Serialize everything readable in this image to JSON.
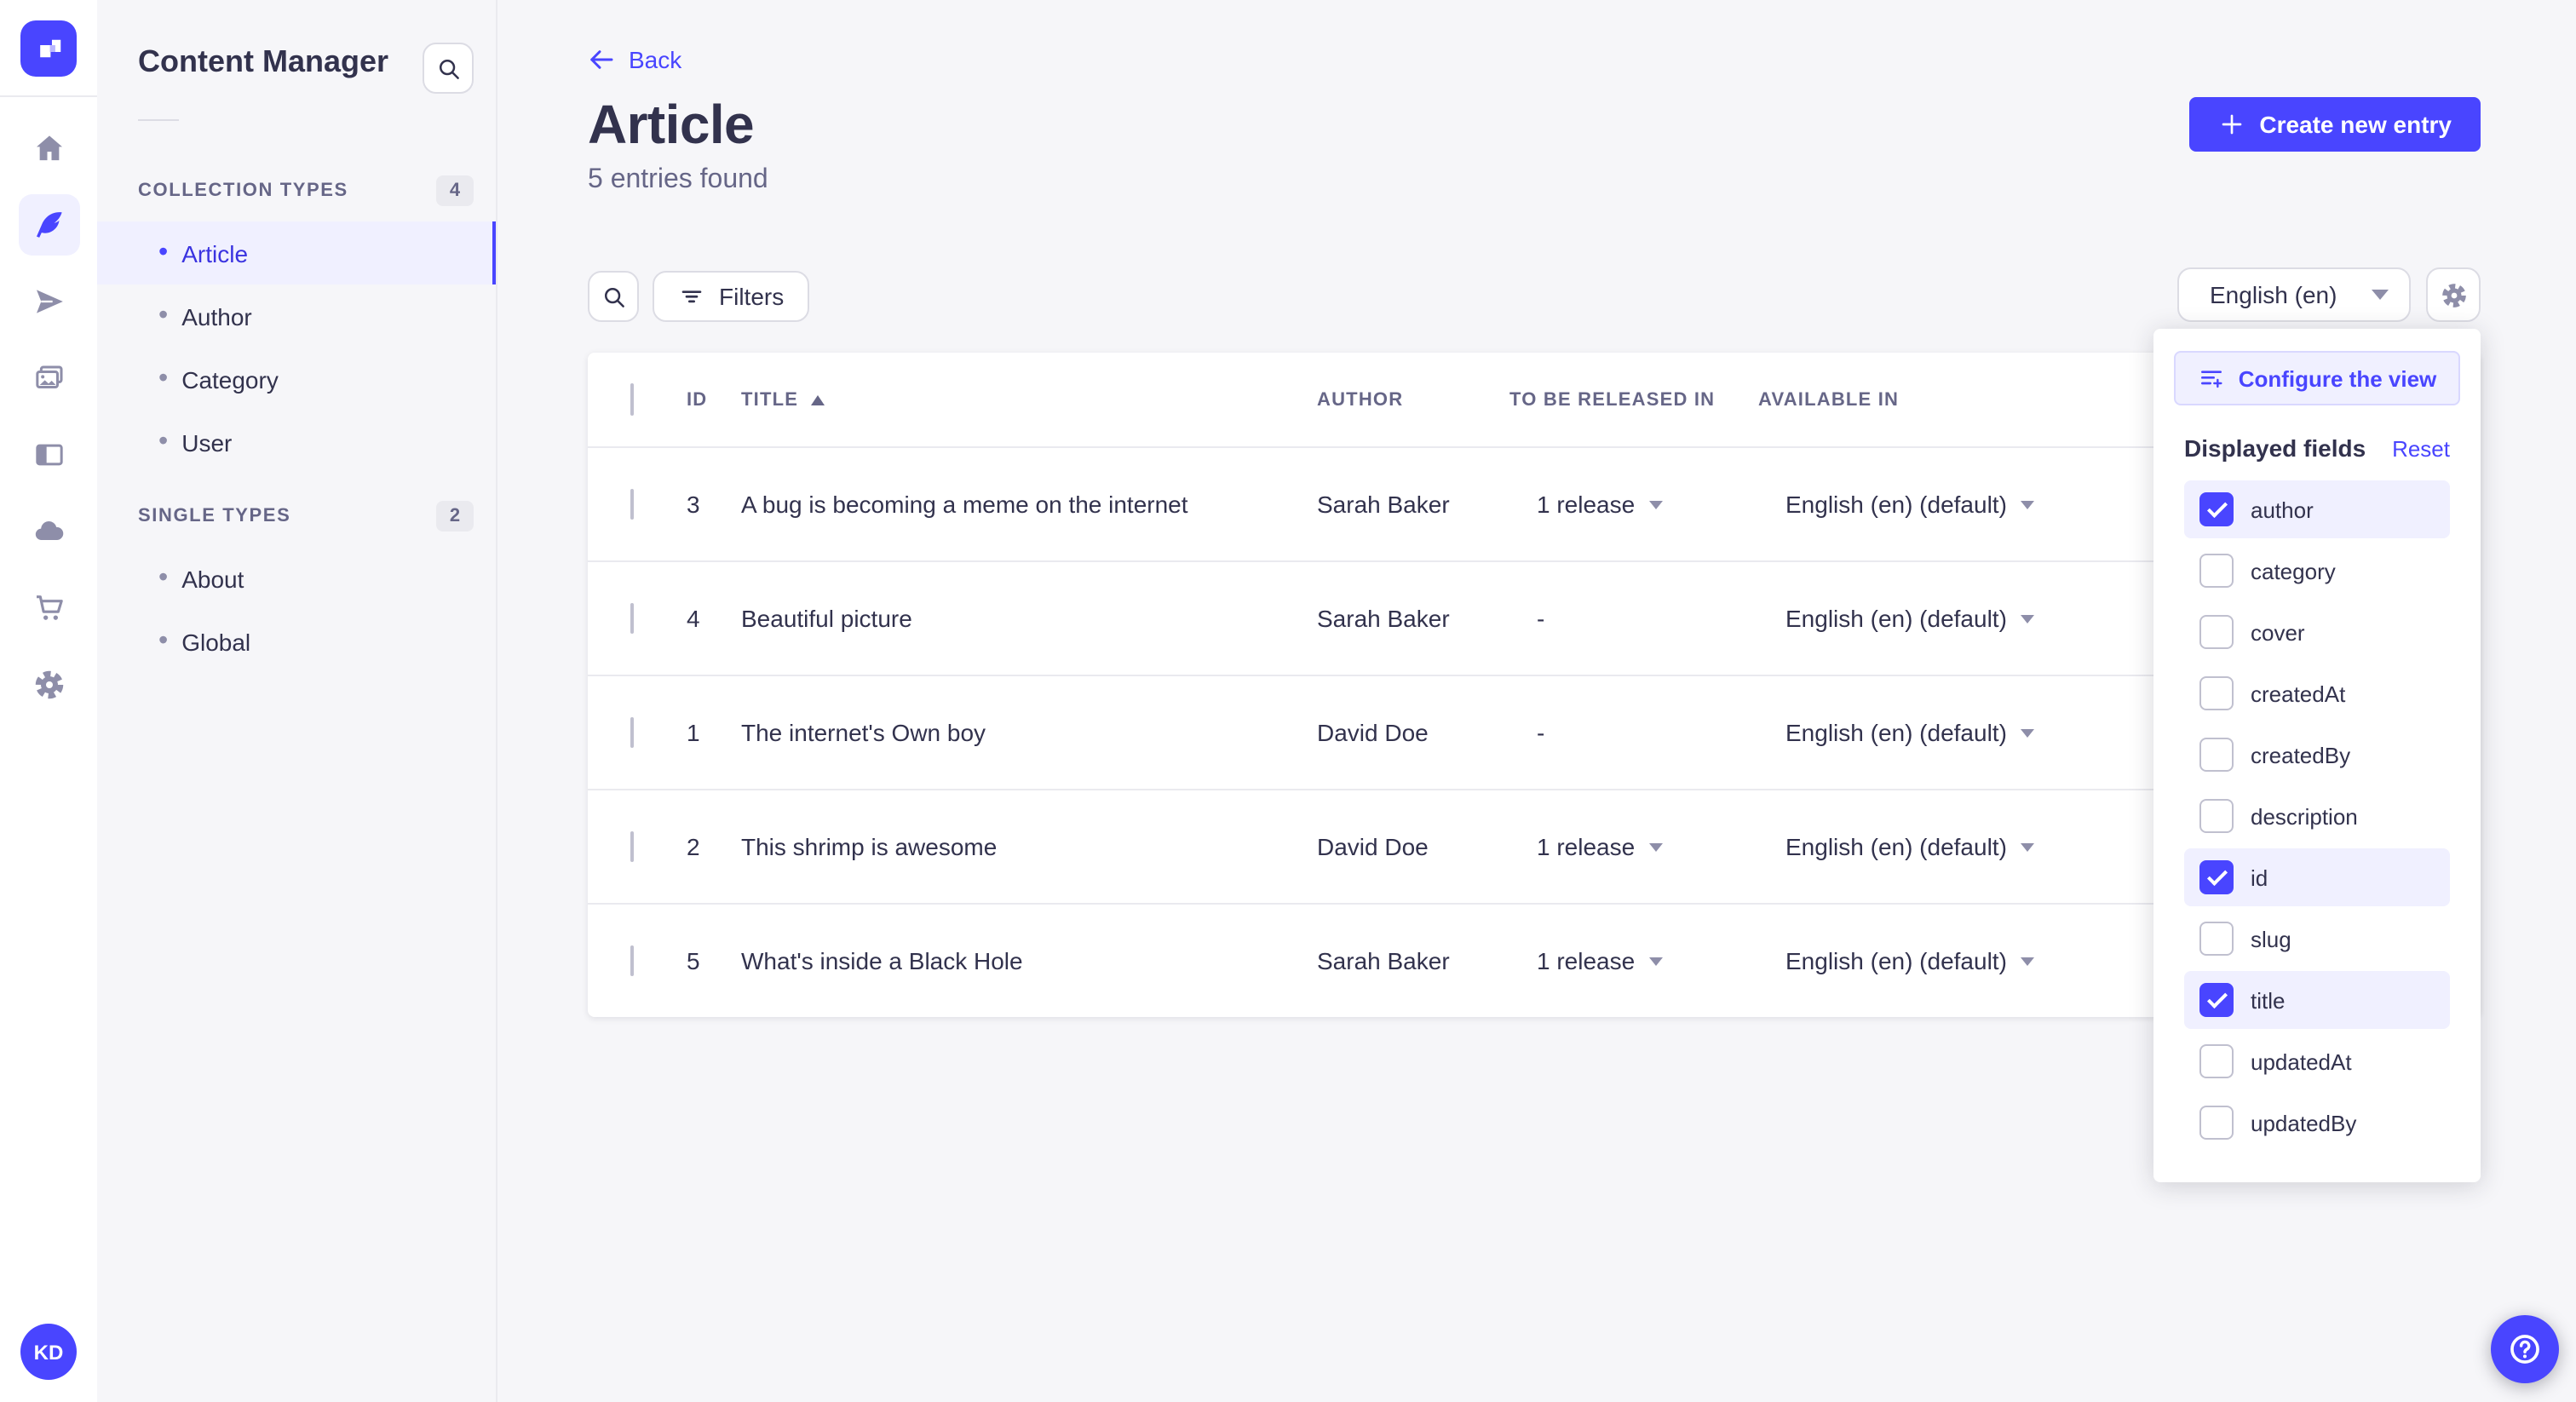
{
  "colors": {
    "primary": "#4945ff",
    "primary_light": "#f0f0ff",
    "primary_border": "#d9d8ff",
    "active_nav_text": "#3a33e0",
    "neutral_bg": "#f6f6f9",
    "border": "#eaeaef",
    "text_dark": "#32324d",
    "text_muted": "#666687",
    "icon_gray": "#8e8ea9"
  },
  "nav_rail": {
    "logo_icon": "strapi-logo",
    "icons": [
      "home-icon",
      "feather-icon",
      "paper-plane-icon",
      "media-gallery-icon",
      "layout-icon",
      "cloud-icon",
      "cart-icon",
      "gear-icon"
    ],
    "active_icon": "feather-icon"
  },
  "avatar": {
    "initials": "KD"
  },
  "subnav": {
    "title": "Content Manager",
    "search_icon": "search-icon",
    "sections": [
      {
        "label": "COLLECTION TYPES",
        "count": "4",
        "items": [
          {
            "label": "Article",
            "active": true
          },
          {
            "label": "Author",
            "active": false
          },
          {
            "label": "Category",
            "active": false
          },
          {
            "label": "User",
            "active": false
          }
        ]
      },
      {
        "label": "SINGLE TYPES",
        "count": "2",
        "items": [
          {
            "label": "About",
            "active": false
          },
          {
            "label": "Global",
            "active": false
          }
        ]
      }
    ]
  },
  "header": {
    "back_label": "Back",
    "title": "Article",
    "subtitle": "5 entries found",
    "create_button": "Create new entry"
  },
  "toolbar": {
    "search_icon": "search-icon",
    "filters_label": "Filters",
    "locale_selector": "English (en)",
    "settings_icon": "gear-icon"
  },
  "table": {
    "columns": [
      {
        "key": "id",
        "label": "ID"
      },
      {
        "key": "title",
        "label": "TITLE",
        "sorted": "asc"
      },
      {
        "key": "author",
        "label": "AUTHOR"
      },
      {
        "key": "released",
        "label": "TO BE RELEASED IN"
      },
      {
        "key": "available",
        "label": "AVAILABLE IN"
      }
    ],
    "rows": [
      {
        "id": "3",
        "title": "A bug is becoming a meme on the internet",
        "author": "Sarah Baker",
        "released": "1 release",
        "available": "English (en) (default)"
      },
      {
        "id": "4",
        "title": "Beautiful picture",
        "author": "Sarah Baker",
        "released": "-",
        "available": "English (en) (default)"
      },
      {
        "id": "1",
        "title": "The internet's Own boy",
        "author": "David Doe",
        "released": "-",
        "available": "English (en) (default)"
      },
      {
        "id": "2",
        "title": "This shrimp is awesome",
        "author": "David Doe",
        "released": "1 release",
        "available": "English (en) (default)"
      },
      {
        "id": "5",
        "title": "What's inside a Black Hole",
        "author": "Sarah Baker",
        "released": "1 release",
        "available": "English (en) (default)"
      }
    ]
  },
  "popover": {
    "configure_button": "Configure the view",
    "configure_icon": "list-plus-icon",
    "heading": "Displayed fields",
    "reset_label": "Reset",
    "fields": [
      {
        "label": "author",
        "checked": true
      },
      {
        "label": "category",
        "checked": false
      },
      {
        "label": "cover",
        "checked": false
      },
      {
        "label": "createdAt",
        "checked": false
      },
      {
        "label": "createdBy",
        "checked": false
      },
      {
        "label": "description",
        "checked": false
      },
      {
        "label": "id",
        "checked": true
      },
      {
        "label": "slug",
        "checked": false
      },
      {
        "label": "title",
        "checked": true
      },
      {
        "label": "updatedAt",
        "checked": false
      },
      {
        "label": "updatedBy",
        "checked": false
      }
    ]
  },
  "help": {
    "icon": "question-circle-icon"
  }
}
